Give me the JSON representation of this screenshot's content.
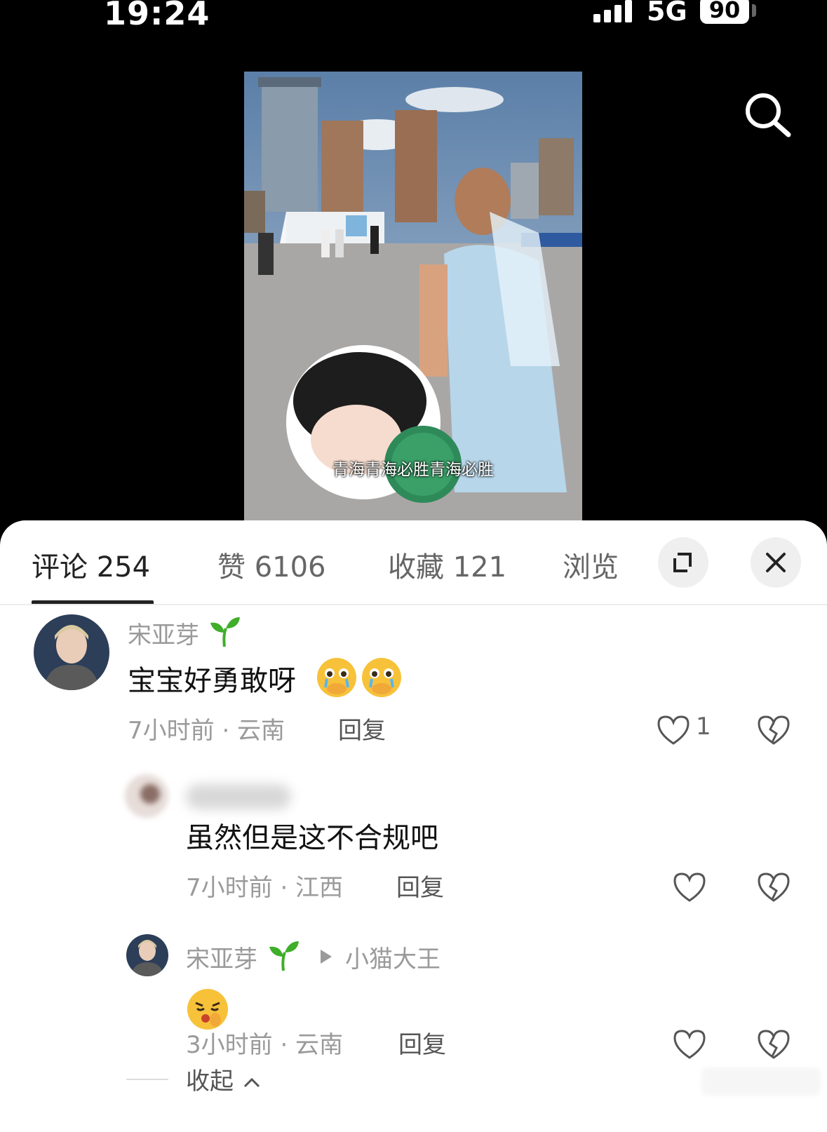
{
  "status_bar": {
    "time": "19:24",
    "network": "5G",
    "battery": "90"
  },
  "video": {
    "subtitle": "青海青海必胜青海必胜"
  },
  "tabs": [
    {
      "label": "评论 254"
    },
    {
      "label": "赞 6106"
    },
    {
      "label": "收藏 121"
    },
    {
      "label": "浏览"
    }
  ],
  "comments": [
    {
      "username": "宋亚芽",
      "text": "宝宝好勇敢呀",
      "meta": "7小时前 · 云南",
      "reply_label": "回复",
      "likes": "1"
    },
    {
      "text": "虽然但是这不合规吧",
      "meta": "7小时前 · 江西",
      "reply_label": "回复"
    },
    {
      "username": "宋亚芽",
      "reply_to": "小猫大王",
      "meta": "3小时前 · 云南",
      "reply_label": "回复"
    }
  ],
  "collapse_label": "收起",
  "colors": {
    "accent_green": "#3fae2a",
    "sheet_bg": "#ffffff",
    "muted": "#9a9a9a"
  }
}
